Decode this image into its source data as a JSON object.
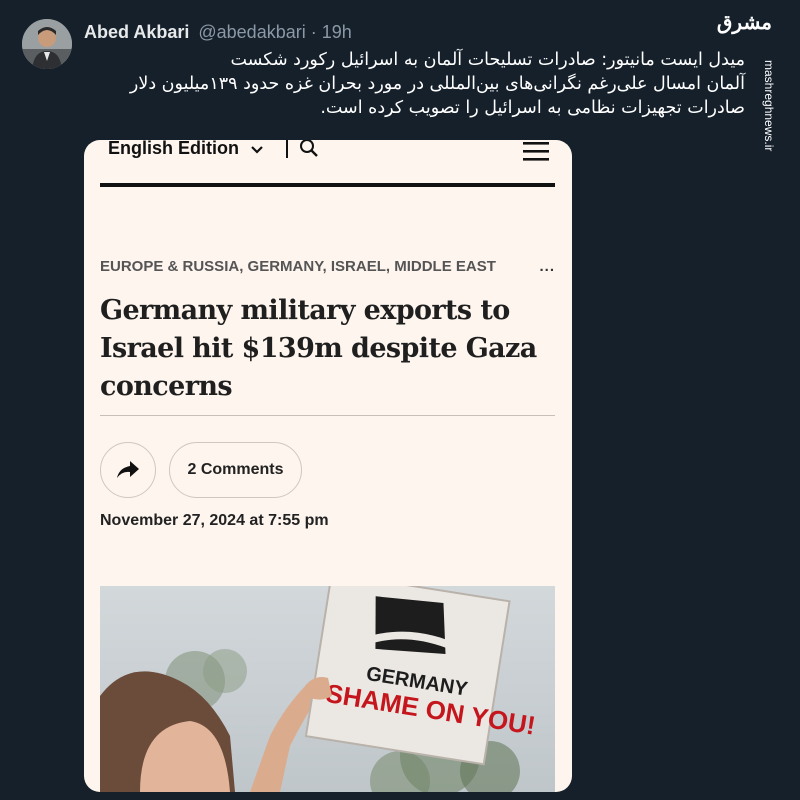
{
  "tweet": {
    "display_name": "Abed Akbari",
    "handle": "@abedakbari",
    "separator": "·",
    "time": "19h",
    "text_lines": [
      "میدل ایست مانیتور: صادرات تسلیحات آلمان به اسرائیل رکورد شکست",
      "آلمان امسال علی‌رغم نگرانی‌های بین‌المللی در مورد بحران غزه حدود ۱۳۹میلیون دلار",
      "صادرات تجهیزات نظامی به اسرائیل را تصویب کرده است."
    ]
  },
  "watermark": {
    "logo_text": "مشرق",
    "url": "mashreghnews.ir"
  },
  "article": {
    "edition_label": "English Edition",
    "categories": "EUROPE & RUSSIA, GERMANY, ISRAEL, MIDDLE EAST",
    "categories_more": "...",
    "headline": "Germany military exports to Israel hit $139m despite Gaza concerns",
    "comments_label": "2 Comments",
    "date": "November 27, 2024 at 7:55 pm",
    "photo_sign": {
      "line1": "GERMANY",
      "line2": "SHAME ON YOU!"
    }
  },
  "colors": {
    "background": "#15202b",
    "card": "#fdf5ee",
    "sign_red": "#c4161c"
  },
  "icons": [
    "chevron-down-icon",
    "search-icon",
    "menu-icon",
    "share-icon"
  ]
}
